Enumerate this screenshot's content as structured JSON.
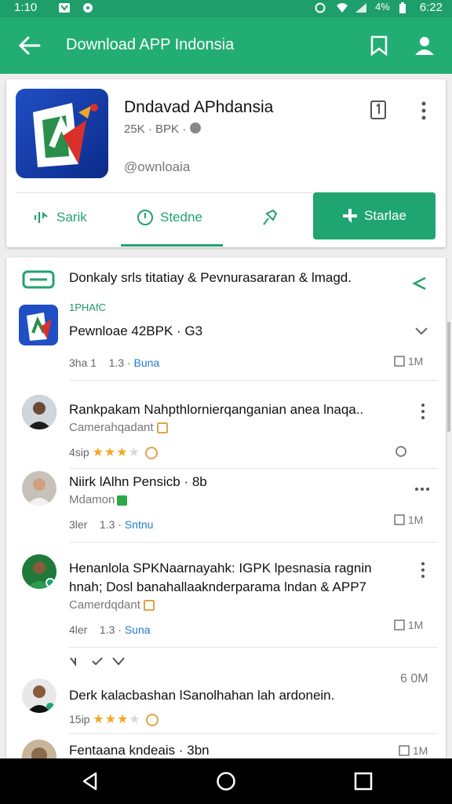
{
  "status": {
    "time_left": "1:10",
    "time_right": "6:22",
    "battery": "4%"
  },
  "appbar": {
    "title": "Download APP Indonsia"
  },
  "app": {
    "name": "Dndavad APhdansia",
    "meta": "25K · BPK ·",
    "developer": "@ownloaia",
    "actions": [
      {
        "label": "Sarik"
      },
      {
        "label": "Stedne"
      }
    ],
    "primary_label": "Starlae"
  },
  "feed": {
    "header": "Donkaly srls titatiay & Pevnurasararan & lmagd.",
    "sub_tag": "1PHAfC",
    "sub_title": "Pewnloae 42BPK · G3",
    "sub_meta_a": "3ha 1",
    "sub_meta_b": "1.3 ·",
    "sub_meta_c": "Buna",
    "sub_right": "1M",
    "reviews": [
      {
        "title": "Rankpakam Nahpthlornierqanganian anea lnaqa..",
        "author": "Camerahqadant",
        "meta": "4sip",
        "stars": 3,
        "right": ""
      },
      {
        "title": "Niirk lAlhn Pensicb · 8b",
        "author": "Mdamon",
        "meta_a": "3ler",
        "meta_b": "1.3 ·",
        "meta_c": "Sntnu",
        "right": "1M"
      },
      {
        "title_line1": "Henanlola SPKNaarnayahk: IGPK lpesnasia ragnin",
        "title_line2": "hnah; Dosl banahallaaknderparama lndan & APP7",
        "author": "Camerdqdant",
        "meta_a": "4ler",
        "meta_b": "1.3 ·",
        "meta_c": "Suna",
        "right": "1M"
      },
      {
        "title": "Derk kalacbashan lSanolhahan lah ardonein.",
        "meta": "15ip",
        "stars": 3,
        "right": "6 0M"
      },
      {
        "title": "Fentaana kndeais · 3bn",
        "right": "1M"
      }
    ]
  }
}
